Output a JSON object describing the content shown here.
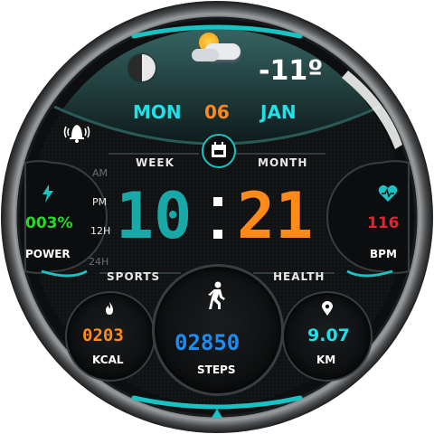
{
  "weather": {
    "temperature": "-11º",
    "icon": "partly-cloudy-sun-icon",
    "moon_icon": "moon-phase-icon"
  },
  "date": {
    "weekday": "MON",
    "day": "06",
    "month": "JAN"
  },
  "labels": {
    "week": "WEEK",
    "month": "MONTH",
    "sports": "SPORTS",
    "health": "HEALTH"
  },
  "time": {
    "hours": "10",
    "minutes": "21",
    "am": "AM",
    "pm": "PM",
    "h12": "12H",
    "h24": "24H"
  },
  "power": {
    "value": "003%",
    "label": "POWER"
  },
  "heart": {
    "value": "116",
    "label": "BPM"
  },
  "calories": {
    "value": "0203",
    "label": "KCAL"
  },
  "steps": {
    "value": "02850",
    "label": "STEPS"
  },
  "distance": {
    "value": "9.07",
    "label": "KM"
  },
  "colors": {
    "accent": "#19c3c3",
    "orange": "#ff8a1a",
    "green": "#22dd22",
    "red": "#e8232a",
    "blue": "#1e8cf0",
    "cyan_value": "#22e0e8"
  }
}
